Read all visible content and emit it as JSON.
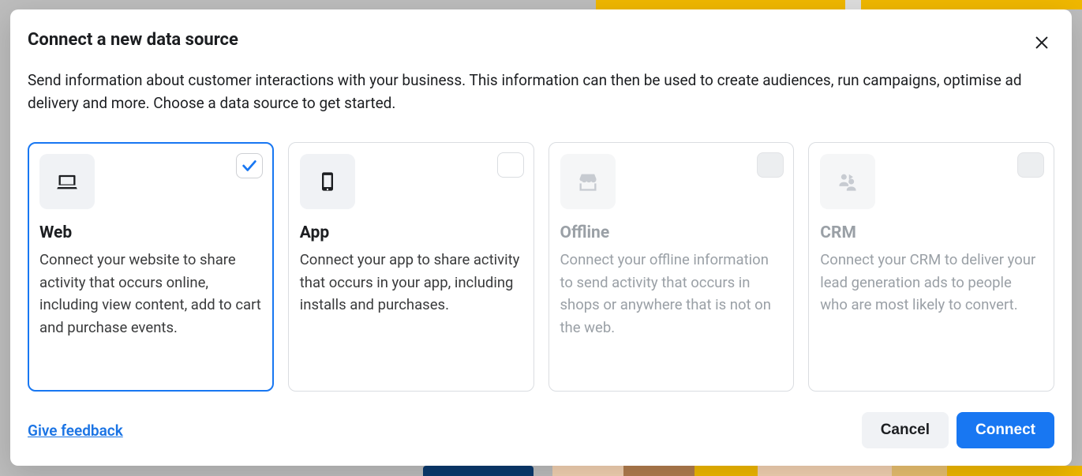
{
  "modal": {
    "title": "Connect a new data source",
    "description": "Send information about customer interactions with your business. This information can then be used to create audiences, run campaigns, optimise ad delivery and more. Choose a data source to get started."
  },
  "options": [
    {
      "id": "web",
      "title": "Web",
      "description": "Connect your website to share activity that occurs online, including view content, add to cart and purchase events.",
      "icon": "laptop-icon",
      "selected": true,
      "enabled": true
    },
    {
      "id": "app",
      "title": "App",
      "description": "Connect your app to share activity that occurs in your app, including installs and purchases.",
      "icon": "phone-icon",
      "selected": false,
      "enabled": true
    },
    {
      "id": "offline",
      "title": "Offline",
      "description": "Connect your offline information to send activity that occurs in shops or anywhere that is not on the web.",
      "icon": "store-icon",
      "selected": false,
      "enabled": false
    },
    {
      "id": "crm",
      "title": "CRM",
      "description": "Connect your CRM to deliver your lead generation ads to people who are most likely to convert.",
      "icon": "people-icon",
      "selected": false,
      "enabled": false
    }
  ],
  "footer": {
    "feedback": "Give feedback",
    "cancel": "Cancel",
    "connect": "Connect"
  },
  "colors": {
    "accent": "#1877f2"
  }
}
